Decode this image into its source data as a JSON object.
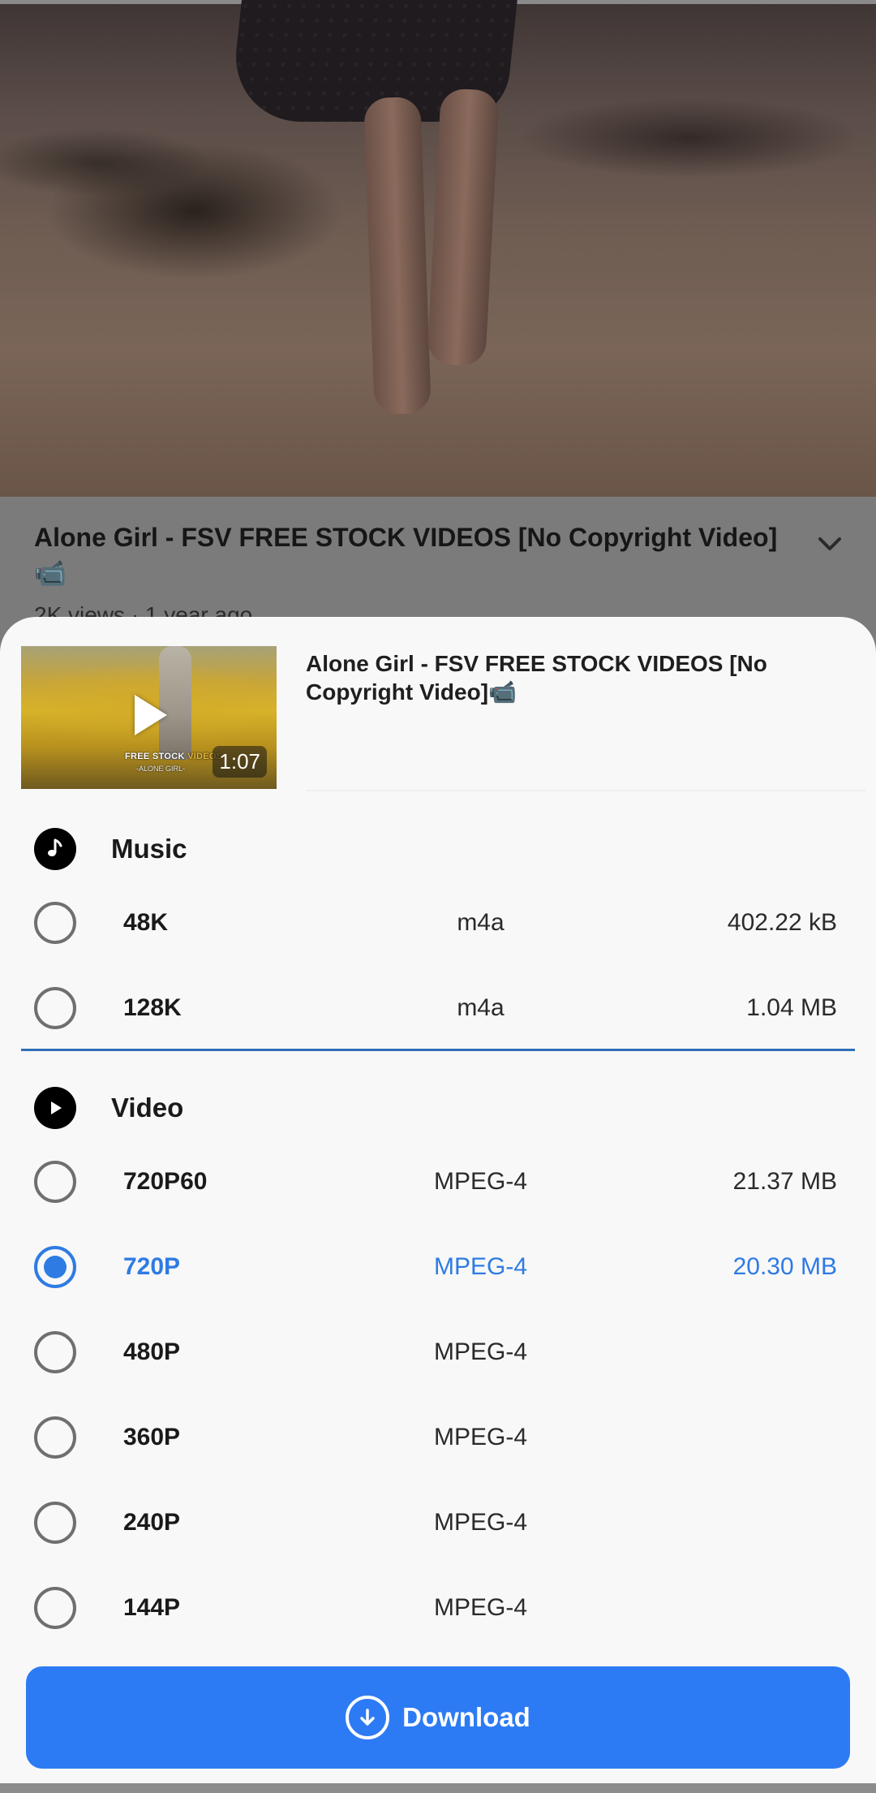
{
  "background": {
    "video_title": "Alone Girl - FSV FREE STOCK VIDEOS  [No  Copyright Video]📹",
    "video_meta": "2K views · 1 year ago"
  },
  "sheet": {
    "title": "Alone Girl - FSV FREE STOCK VIDEOS  [No  Copyright Video]📹",
    "thumbnail": {
      "duration": "1:07",
      "brand_line1_a": "FREE STOCK ",
      "brand_line1_b": "VIDEOS",
      "brand_line2": "-ALONE GIRL-"
    },
    "music": {
      "label": "Music",
      "icon": "music-note-icon",
      "options": [
        {
          "quality": "48K",
          "format": "m4a",
          "size": "402.22 kB",
          "selected": false
        },
        {
          "quality": "128K",
          "format": "m4a",
          "size": "1.04 MB",
          "selected": false
        }
      ]
    },
    "video": {
      "label": "Video",
      "icon": "play-icon",
      "options": [
        {
          "quality": "720P60",
          "format": "MPEG-4",
          "size": "21.37 MB",
          "selected": false
        },
        {
          "quality": "720P",
          "format": "MPEG-4",
          "size": "20.30 MB",
          "selected": true
        },
        {
          "quality": "480P",
          "format": "MPEG-4",
          "size": "",
          "selected": false
        },
        {
          "quality": "360P",
          "format": "MPEG-4",
          "size": "",
          "selected": false
        },
        {
          "quality": "240P",
          "format": "MPEG-4",
          "size": "",
          "selected": false
        },
        {
          "quality": "144P",
          "format": "MPEG-4",
          "size": "",
          "selected": false
        }
      ]
    },
    "download_label": "Download"
  },
  "colors": {
    "accent": "#2e7be3",
    "button": "#2d7bf4",
    "sheet_bg": "#f8f8f8"
  }
}
